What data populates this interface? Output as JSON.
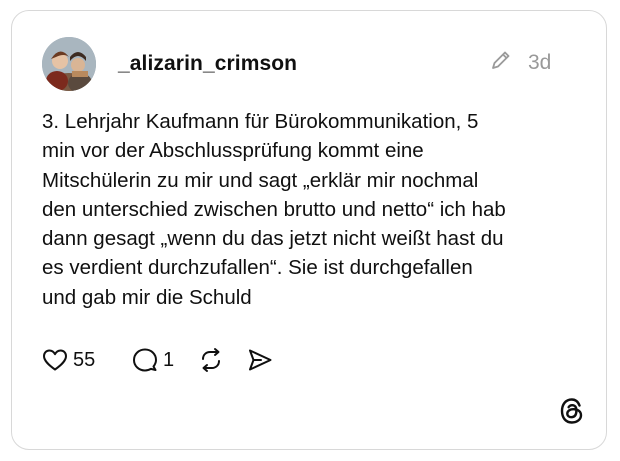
{
  "post": {
    "username": "_alizarin_crimson",
    "time": "3d",
    "text": "3. Lehrjahr Kaufmann für Bürokommunikation, 5\nmin vor der Abschlussprüfung kommt eine\nMitschülerin zu mir und sagt „erklär mir nochmal\nden unterschied zwischen brutto und netto“ ich hab\ndann gesagt „wenn du das jetzt nicht weißt hast du\nes verdient durchzufallen“. Sie ist durchgefallen\nund gab mir die Schuld",
    "likes": "55",
    "replies": "1"
  },
  "icons": {
    "avatar": "profile-photo",
    "edit": "pencil-icon",
    "like": "heart-icon",
    "reply": "speech-bubble-icon",
    "repost": "repost-icon",
    "share": "send-icon",
    "brand": "threads-logo"
  },
  "colors": {
    "text": "#101010",
    "muted": "#999999",
    "border": "#d8d8d8",
    "background": "#ffffff"
  }
}
